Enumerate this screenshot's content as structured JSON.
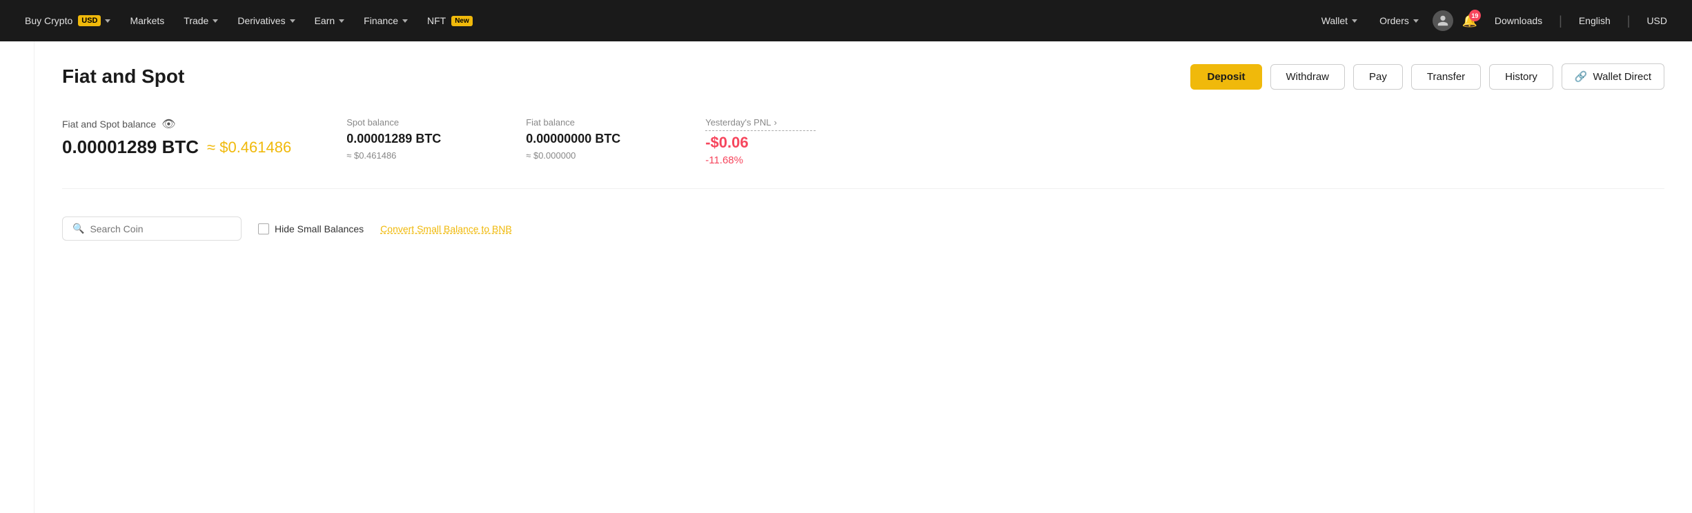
{
  "navbar": {
    "nav_left": [
      {
        "id": "buy-crypto",
        "label": "Buy Crypto",
        "badge": "USD",
        "has_chevron": true
      },
      {
        "id": "markets",
        "label": "Markets",
        "has_chevron": false
      },
      {
        "id": "trade",
        "label": "Trade",
        "has_chevron": true
      },
      {
        "id": "derivatives",
        "label": "Derivatives",
        "has_chevron": true
      },
      {
        "id": "earn",
        "label": "Earn",
        "has_chevron": true
      },
      {
        "id": "finance",
        "label": "Finance",
        "has_chevron": true
      },
      {
        "id": "nft",
        "label": "NFT",
        "badge": "New",
        "has_chevron": false
      }
    ],
    "nav_right": [
      {
        "id": "wallet",
        "label": "Wallet",
        "has_chevron": true
      },
      {
        "id": "orders",
        "label": "Orders",
        "has_chevron": true
      }
    ],
    "notification_count": "19",
    "downloads_label": "Downloads",
    "language_label": "English",
    "currency_label": "USD"
  },
  "page": {
    "title": "Fiat and Spot",
    "actions": {
      "deposit": "Deposit",
      "withdraw": "Withdraw",
      "pay": "Pay",
      "transfer": "Transfer",
      "history": "History",
      "wallet_direct": "Wallet Direct"
    }
  },
  "balance": {
    "label": "Fiat and Spot balance",
    "btc": "0.00001289 BTC",
    "usd": "≈ $0.461486",
    "spot_label": "Spot balance",
    "spot_btc": "0.00001289 BTC",
    "spot_usd": "≈ $0.461486",
    "fiat_label": "Fiat balance",
    "fiat_btc": "0.00000000 BTC",
    "fiat_usd": "≈ $0.000000",
    "pnl_label": "Yesterday's PNL",
    "pnl_value": "-$0.06",
    "pnl_percent": "-11.68%"
  },
  "filter": {
    "search_placeholder": "Search Coin",
    "hide_label": "Hide Small Balances",
    "convert_label": "Convert Small Balance to BNB"
  }
}
